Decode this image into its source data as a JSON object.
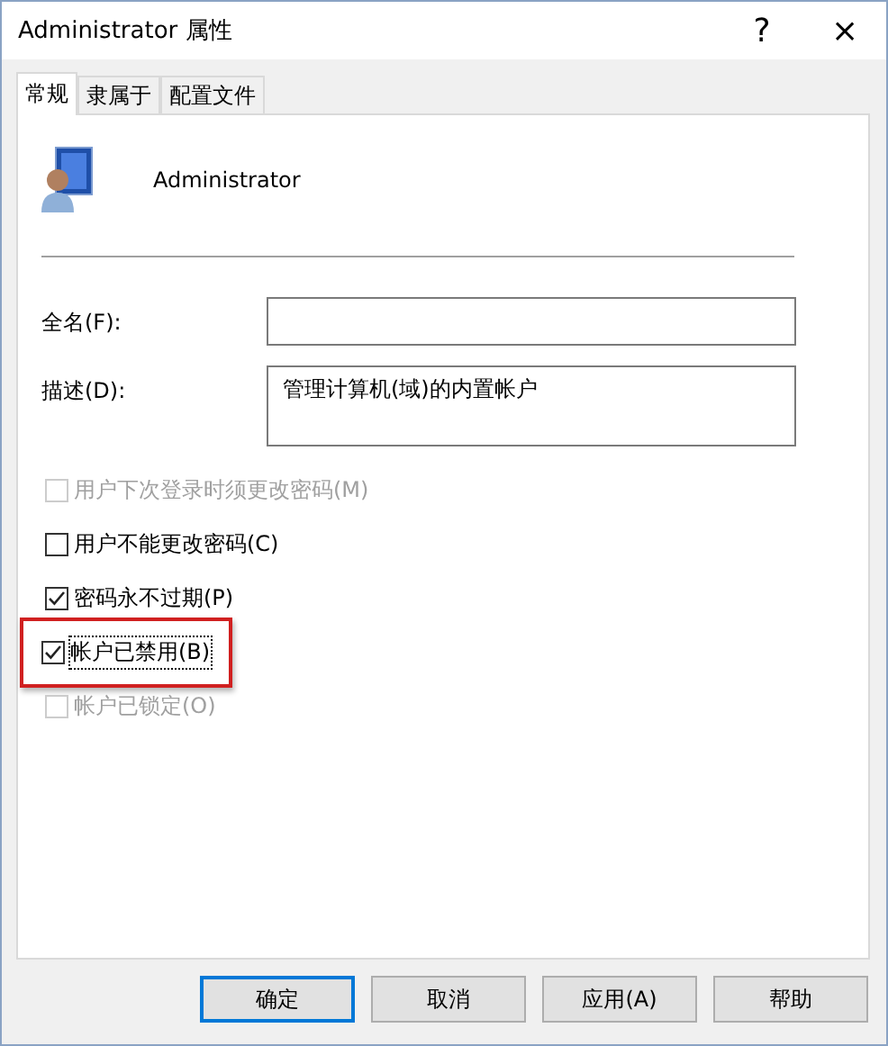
{
  "window": {
    "title": "Administrator 属性",
    "help": "?",
    "close": "×"
  },
  "tabs": [
    {
      "label": "常规",
      "selected": true
    },
    {
      "label": "隶属于",
      "selected": false
    },
    {
      "label": "配置文件",
      "selected": false
    }
  ],
  "user": {
    "name": "Administrator"
  },
  "fields": [
    {
      "label": "全名(F):",
      "multiline": false
    },
    {
      "label": "描述(D):",
      "value": "管理计算机(域)的内置帐户",
      "multiline": true
    }
  ],
  "options": [
    {
      "label": "用户下次登录时须更改密码(M)",
      "checked": false,
      "disabled": true,
      "focused": false,
      "highlighted": false
    },
    {
      "label": "用户不能更改密码(C)",
      "checked": false,
      "disabled": false,
      "focused": false,
      "highlighted": false
    },
    {
      "label": "密码永不过期(P)",
      "checked": true,
      "disabled": false,
      "focused": false,
      "highlighted": false
    },
    {
      "label": "帐户已禁用(B)",
      "checked": true,
      "disabled": false,
      "focused": true,
      "highlighted": true
    },
    {
      "label": "帐户已锁定(O)",
      "checked": false,
      "disabled": true,
      "focused": false,
      "highlighted": false
    }
  ],
  "buttons": [
    {
      "label": "确定",
      "default": true
    },
    {
      "label": "取消",
      "default": false
    },
    {
      "label": "应用(A)",
      "default": false
    },
    {
      "label": "帮助",
      "default": false
    }
  ]
}
